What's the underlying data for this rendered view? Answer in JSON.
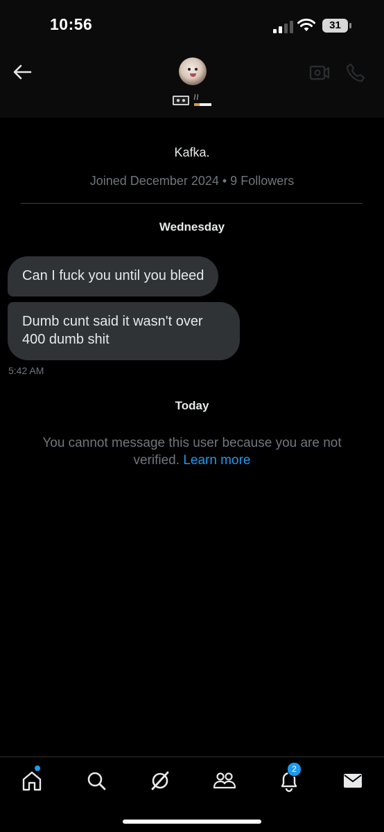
{
  "status_bar": {
    "time": "10:56",
    "battery": "31",
    "icons": [
      "signal-icon",
      "wifi-icon",
      "battery-icon"
    ]
  },
  "header": {
    "icons": [
      "back-arrow-icon",
      "video-camera-icon",
      "phone-icon"
    ],
    "display_name_emojis": [
      "vhs-tape-emoji",
      "cigarette-emoji"
    ]
  },
  "profile": {
    "name": "Kafka.",
    "meta": "Joined December 2024 • 9 Followers"
  },
  "conversation": {
    "day_1": "Wednesday",
    "messages": [
      {
        "text": "Can I fuck you until you bleed"
      },
      {
        "text": "Dumb cunt said it wasn't over 400 dumb shit"
      }
    ],
    "timestamp": "5:42 AM",
    "day_2": "Today"
  },
  "notice": {
    "text": "You cannot message this user because you are not verified.",
    "link": "Learn more"
  },
  "bottom_nav": {
    "items": [
      "home-icon",
      "search-icon",
      "grok-icon",
      "communities-icon",
      "notifications-icon",
      "messages-icon"
    ],
    "notifications_badge": "2"
  },
  "colors": {
    "background": "#000000",
    "bubble": "#2f3336",
    "muted_text": "#71767b",
    "accent": "#1d9bf0"
  }
}
